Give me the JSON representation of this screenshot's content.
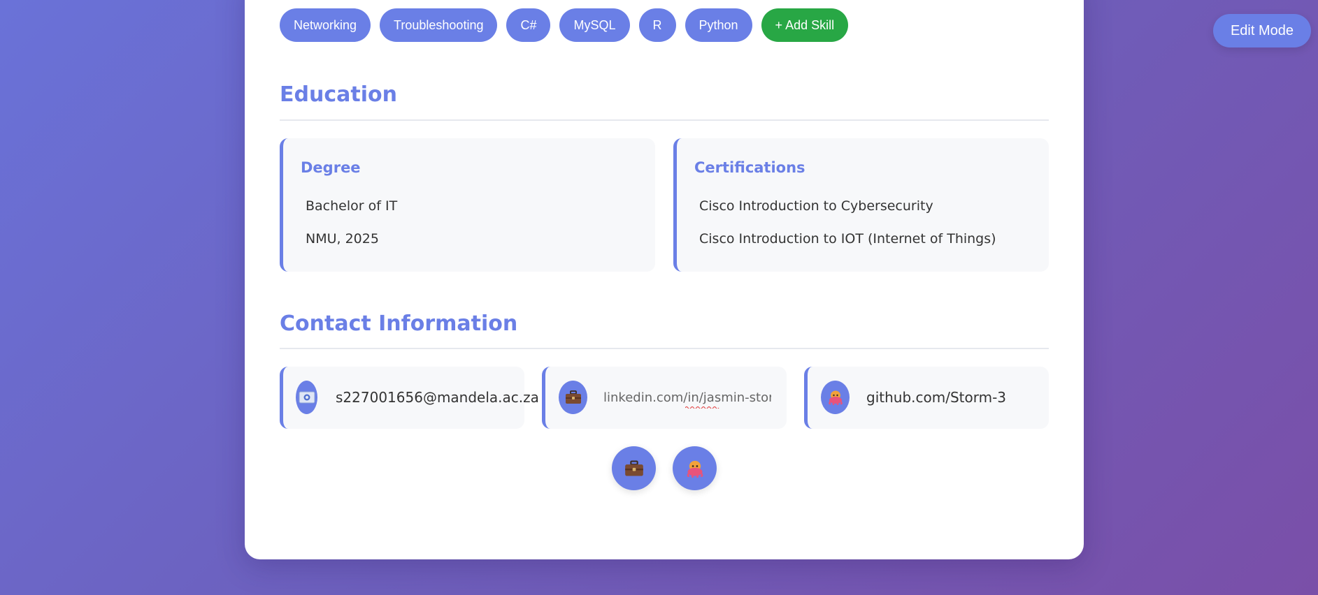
{
  "edit_mode_label": "Edit Mode",
  "skills": [
    "Networking",
    "Troubleshooting",
    "C#",
    "MySQL",
    "R",
    "Python"
  ],
  "add_skill_label": "+ Add Skill",
  "education": {
    "title": "Education",
    "degree": {
      "heading": "Degree",
      "lines": [
        "Bachelor of IT",
        "NMU, 2025"
      ]
    },
    "certifications": {
      "heading": "Certifications",
      "lines": [
        "Cisco Introduction to Cybersecurity",
        "Cisco Introduction to IOT (Internet of Things)"
      ]
    }
  },
  "contact": {
    "title": "Contact Information",
    "email": {
      "icon": "id-card-icon",
      "value": "s227001656@mandela.ac.za"
    },
    "linkedin": {
      "icon": "briefcase-icon",
      "value": "linkedin.com/in/jasmin-storm"
    },
    "github": {
      "icon": "octopus-icon",
      "value": "github.com/Storm-3"
    }
  },
  "social_links": [
    {
      "icon": "briefcase-icon",
      "label": "LinkedIn"
    },
    {
      "icon": "octopus-icon",
      "label": "GitHub"
    }
  ],
  "colors": {
    "accent": "#6a7fe6",
    "add_button": "#28a745",
    "card_bg": "#f7f8fa"
  }
}
